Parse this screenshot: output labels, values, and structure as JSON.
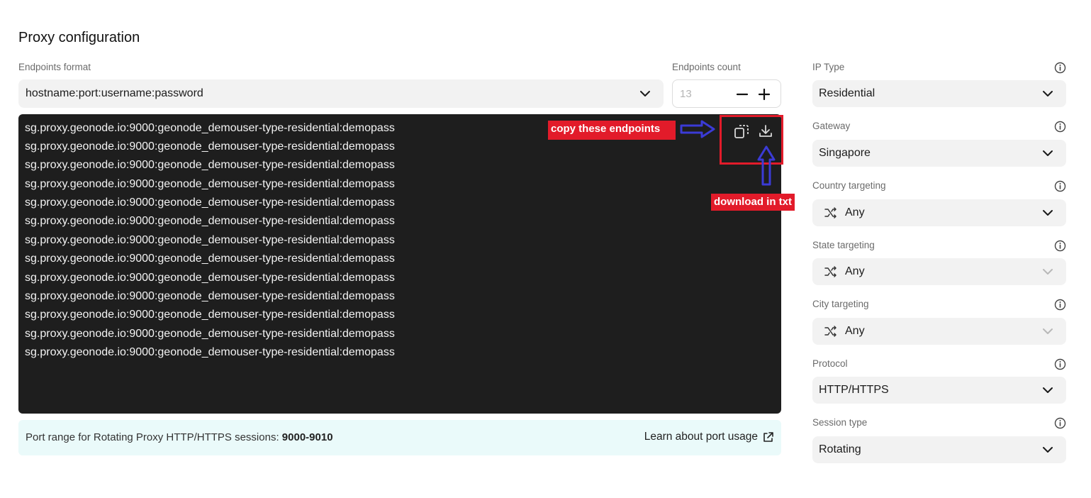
{
  "page": {
    "title": "Proxy configuration"
  },
  "endpoints_format": {
    "label": "Endpoints format",
    "value": "hostname:port:username:password"
  },
  "endpoints_count": {
    "label": "Endpoints count",
    "value": "13"
  },
  "endpoints": [
    "sg.proxy.geonode.io:9000:geonode_demouser-type-residential:demopass",
    "sg.proxy.geonode.io:9000:geonode_demouser-type-residential:demopass",
    "sg.proxy.geonode.io:9000:geonode_demouser-type-residential:demopass",
    "sg.proxy.geonode.io:9000:geonode_demouser-type-residential:demopass",
    "sg.proxy.geonode.io:9000:geonode_demouser-type-residential:demopass",
    "sg.proxy.geonode.io:9000:geonode_demouser-type-residential:demopass",
    "sg.proxy.geonode.io:9000:geonode_demouser-type-residential:demopass",
    "sg.proxy.geonode.io:9000:geonode_demouser-type-residential:demopass",
    "sg.proxy.geonode.io:9000:geonode_demouser-type-residential:demopass",
    "sg.proxy.geonode.io:9000:geonode_demouser-type-residential:demopass",
    "sg.proxy.geonode.io:9000:geonode_demouser-type-residential:demopass",
    "sg.proxy.geonode.io:9000:geonode_demouser-type-residential:demopass",
    "sg.proxy.geonode.io:9000:geonode_demouser-type-residential:demopass"
  ],
  "annotations": {
    "copy": "copy these endpoints",
    "download": "download in txt"
  },
  "port_info": {
    "text": "Port range for Rotating Proxy HTTP/HTTPS sessions:",
    "range": "9000-9010",
    "link": "Learn about port usage"
  },
  "settings": {
    "ip_type": {
      "label": "IP Type",
      "value": "Residential"
    },
    "gateway": {
      "label": "Gateway",
      "value": "Singapore"
    },
    "country": {
      "label": "Country targeting",
      "value": "Any"
    },
    "state": {
      "label": "State targeting",
      "value": "Any"
    },
    "city": {
      "label": "City targeting",
      "value": "Any"
    },
    "protocol": {
      "label": "Protocol",
      "value": "HTTP/HTTPS"
    },
    "session": {
      "label": "Session type",
      "value": "Rotating"
    }
  },
  "colors": {
    "annotation_red": "#e21b2a",
    "annotation_arrow": "#3b3bd6",
    "terminal_bg": "#1e1e1e",
    "info_bg": "#eafafa"
  }
}
